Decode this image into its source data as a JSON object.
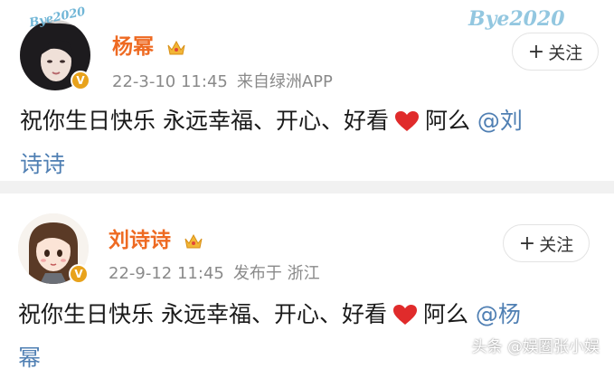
{
  "posts": [
    {
      "author": "杨幂",
      "time": "22-3-10 11:45",
      "source": "来自绿洲APP",
      "follow_label": "关注",
      "content_text": "祝你生日快乐 永远幸福、开心、好看",
      "content_suffix": "阿么",
      "mention_line1": "@刘",
      "mention_line2": "诗诗",
      "decoration": "Bye2020"
    },
    {
      "author": "刘诗诗",
      "time": "22-9-12 11:45",
      "source": "发布于 浙江",
      "follow_label": "关注",
      "content_text": "祝你生日快乐 永远幸福、开心、好看",
      "content_suffix": "阿么",
      "mention_line1": "@杨",
      "mention_line2": "幂"
    }
  ],
  "watermark": "头条 @娱圈张小娱",
  "colors": {
    "username": "#ee6a22",
    "mention": "#4f7fb3",
    "meta": "#8a8a8a",
    "heart": "#e02b2b",
    "badge": "#e8a21b"
  }
}
